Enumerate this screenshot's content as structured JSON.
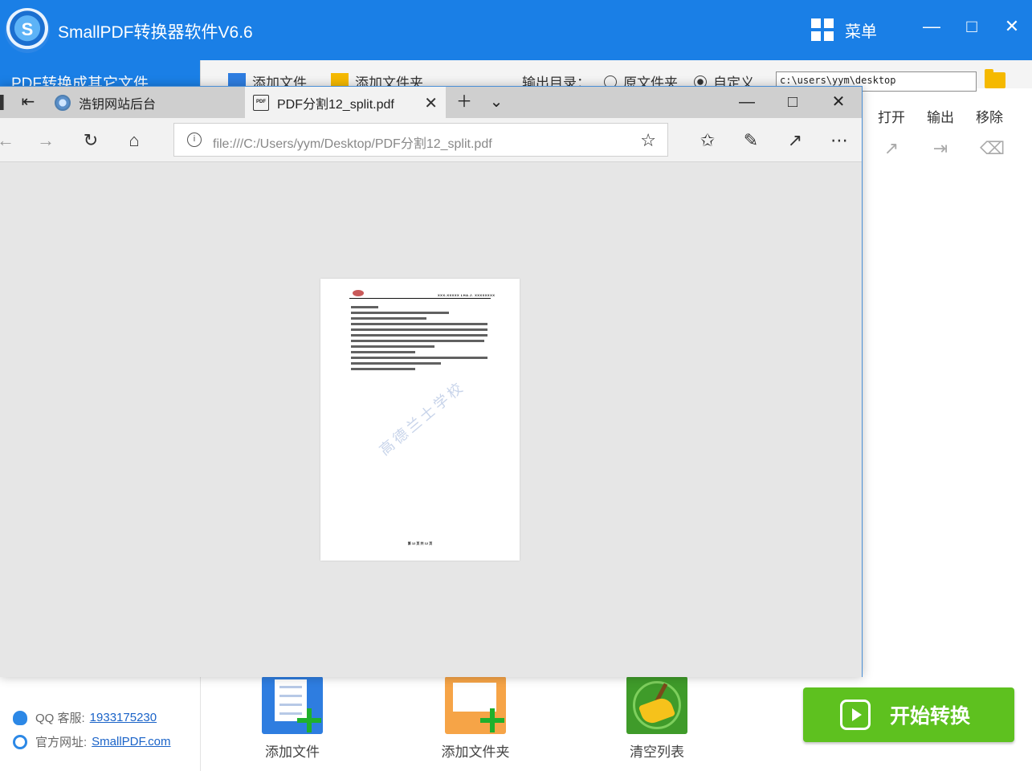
{
  "app": {
    "title": "SmallPDF转换器软件V6.6",
    "logo_letter": "S",
    "menu_label": "菜单",
    "left_tab": "PDF转换成其它文件",
    "toolbar": {
      "add_file": "添加文件",
      "add_folder": "添加文件夹",
      "output_dir_label": "输出目录：",
      "radio_source": "原文件夹",
      "radio_custom": "自定义",
      "output_path": "c:\\users\\yym\\desktop"
    },
    "columns": {
      "open": "打开",
      "output": "输出",
      "remove": "移除"
    },
    "bottom": {
      "add_file": "添加文件",
      "add_folder": "添加文件夹",
      "clear_list": "清空列表",
      "start": "开始转换"
    },
    "contact": {
      "qq_label": "QQ 客服:",
      "qq_value": "1933175230",
      "site_label": "官方网址:",
      "site_value": "SmallPDF.com"
    },
    "accent_color": "#1a7fe6",
    "start_color": "#5ec11f"
  },
  "browser": {
    "tabs": [
      {
        "title": "浩钥网站后台",
        "icon": "globe-icon",
        "active": false
      },
      {
        "title": "PDF分割12_split.pdf",
        "icon": "pdf-icon",
        "active": true
      }
    ],
    "address": "file:///C:/Users/yym/Desktop/PDF分割12_split.pdf",
    "pdf": {
      "header_text": "XXX-XXXXX LHA.J. XXXXXXXX",
      "footer_text": "第 12 页 共 12 页",
      "watermark": "高德兰士学校"
    }
  }
}
